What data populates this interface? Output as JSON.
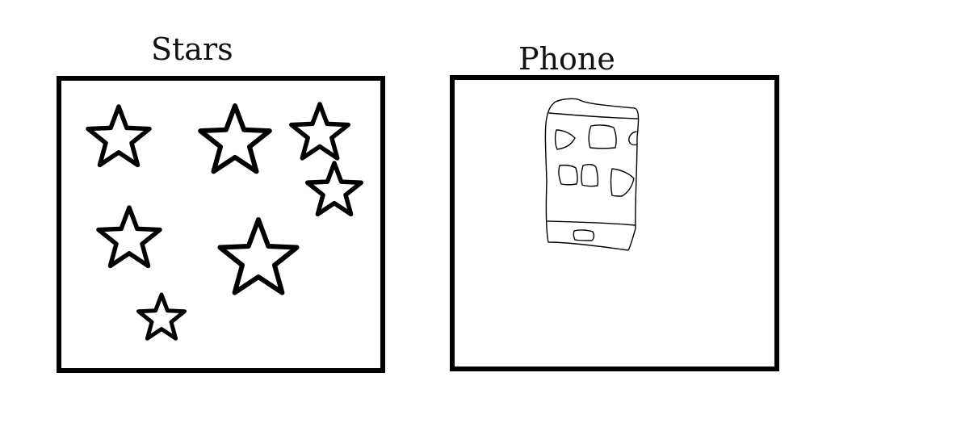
{
  "labels": {
    "left": "Stars",
    "right": "Phone"
  },
  "colors": {
    "stroke": "#000000",
    "background": "#ffffff"
  },
  "icons": {
    "left_panel": "star-icon",
    "right_panel": "phone-icon"
  }
}
